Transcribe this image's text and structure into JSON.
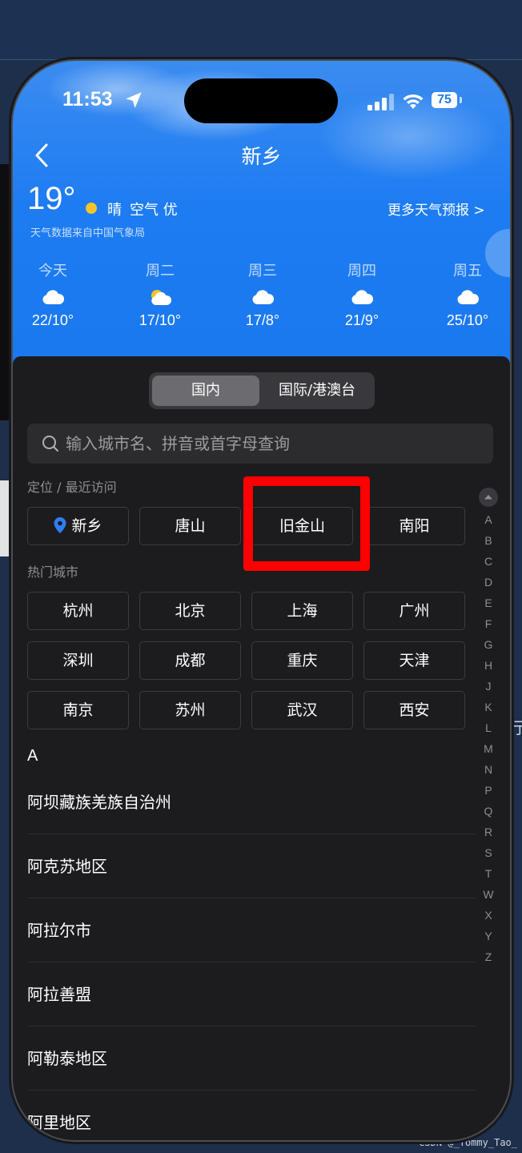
{
  "status": {
    "time": "11:53",
    "battery": "75"
  },
  "header": {
    "city": "新乡"
  },
  "current": {
    "temp": "19°",
    "condition": "晴",
    "air": "空气 优",
    "source": "天气数据来自中国气象局",
    "more_forecast": "更多天气预报 >"
  },
  "forecast": [
    {
      "day": "今天",
      "icon": "cloud-icon",
      "range": "22/10°"
    },
    {
      "day": "周二",
      "icon": "partly-cloudy-icon",
      "range": "17/10°"
    },
    {
      "day": "周三",
      "icon": "cloud-icon",
      "range": "17/8°"
    },
    {
      "day": "周四",
      "icon": "cloud-icon",
      "range": "21/9°"
    },
    {
      "day": "周五",
      "icon": "cloud-icon",
      "range": "25/10°"
    }
  ],
  "tabs": {
    "domestic": "国内",
    "international": "国际/港澳台"
  },
  "search": {
    "placeholder": "输入城市名、拼音或首字母查询"
  },
  "recent": {
    "label": "定位 / 最近访问",
    "items": [
      "新乡",
      "唐山",
      "旧金山",
      "南阳"
    ]
  },
  "hot": {
    "label": "热门城市",
    "items": [
      "杭州",
      "北京",
      "上海",
      "广州",
      "深圳",
      "成都",
      "重庆",
      "天津",
      "南京",
      "苏州",
      "武汉",
      "西安"
    ]
  },
  "index_letters": [
    "A",
    "B",
    "C",
    "D",
    "E",
    "F",
    "G",
    "H",
    "J",
    "K",
    "L",
    "M",
    "N",
    "P",
    "Q",
    "R",
    "S",
    "T",
    "W",
    "X",
    "Y",
    "Z"
  ],
  "list": {
    "letter": "A",
    "items": [
      "阿坝藏族羌族自治州",
      "阿克苏地区",
      "阿拉尔市",
      "阿拉善盟",
      "阿勒泰地区",
      "阿里地区"
    ]
  },
  "background": {
    "side_char": "行",
    "watermark": "CSDN @_Tommy_Tao_"
  },
  "colors": {
    "sky": "#1e7cf2",
    "sheet": "#1c1c1e",
    "highlight": "#ff0000",
    "sun": "#f6c42a"
  }
}
